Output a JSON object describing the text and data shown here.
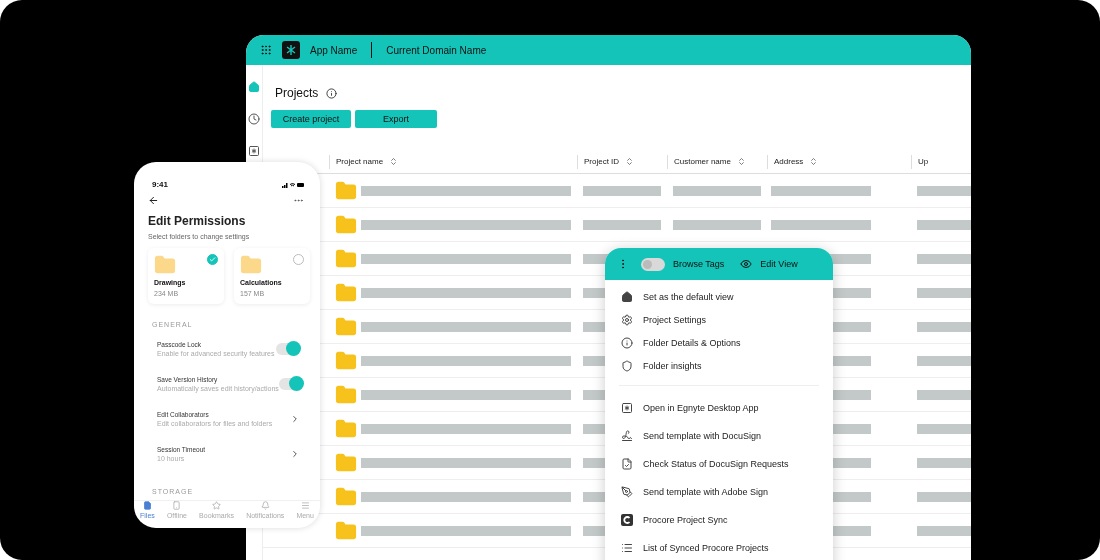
{
  "app_bar": {
    "app_name": "App Name",
    "domain": "Current Domain Name"
  },
  "page": {
    "title": "Projects",
    "buttons": [
      "Create project",
      "Export"
    ]
  },
  "table": {
    "columns": [
      "Project name",
      "Project ID",
      "Customer name",
      "Address",
      "Up"
    ]
  },
  "context_menu": {
    "toggle": {
      "label": "Browse Tags",
      "on": false
    },
    "edit_view": "Edit View",
    "groups": [
      [
        "Set as the default view",
        "Project Settings",
        "Folder Details & Options",
        "Folder insights"
      ],
      [
        "Open in Egnyte Desktop App",
        "Send template with DocuSign",
        "Check Status of DocuSign Requests",
        "Send template with Adobe Sign",
        "Procore Project Sync",
        "List of Synced Procore Projects"
      ]
    ]
  },
  "phone": {
    "time": "9:41",
    "title": "Edit Permissions",
    "subtitle": "Select folders to change settings",
    "folders": [
      {
        "name": "Drawings",
        "size": "234 MB",
        "selected": true
      },
      {
        "name": "Calculations",
        "size": "157 MB",
        "selected": false
      }
    ],
    "general_heading": "GENERAL",
    "settings": [
      {
        "kind": "toggle",
        "title": "Passcode Lock",
        "description": "Enable for advanced security features",
        "on": true
      },
      {
        "kind": "toggle",
        "title": "Save Version History",
        "description": "Automatically saves edit history/actions",
        "on": true
      },
      {
        "kind": "link",
        "title": "Edit Collaborators",
        "description": "Edit collaborators for files and folders"
      },
      {
        "kind": "link",
        "title": "Session Timeout",
        "description": "10 hours"
      }
    ],
    "storage_heading": "STORAGE",
    "tabs": [
      {
        "label": "Files",
        "selected": true
      },
      {
        "label": "Offline",
        "selected": false
      },
      {
        "label": "Bookmarks",
        "selected": false
      },
      {
        "label": "Notifications",
        "selected": false
      },
      {
        "label": "Menu",
        "selected": false
      }
    ]
  }
}
